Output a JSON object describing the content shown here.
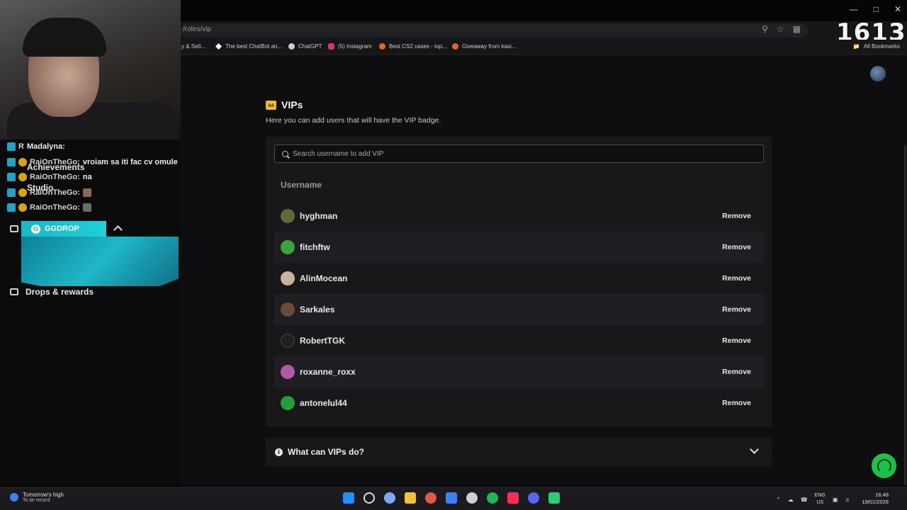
{
  "browser": {
    "url": "/roles/vip",
    "counter": "1613",
    "bookmarks": [
      "y & Sell...",
      "The best ChatBot an...",
      "ChatGPT",
      "(5) Instagram",
      "Best CS2 cases - top...",
      "Giveaway from kasi..."
    ],
    "all_bookmarks": "All Bookmarks",
    "colors": {
      "bm1": "#4a4a4a",
      "bm2": "#ffffff",
      "bm3": "#cfcfcf",
      "bm4": "#e1306c",
      "bm5": "#e0672a",
      "bm6": "#e0672a"
    }
  },
  "page": {
    "section_title": "VIPs",
    "subtitle": "Here you can add users that will have the VIP badge.",
    "search_placeholder": "Search username to add VIP",
    "column_header": "Username",
    "remove_label": "Remove",
    "users": [
      {
        "name": "hyghman",
        "color": "#5c6b3a"
      },
      {
        "name": "fitchftw",
        "color": "#3aa53a"
      },
      {
        "name": "AlinMocean",
        "color": "#c9b29a"
      },
      {
        "name": "Sarkales",
        "color": "#6b4b3a"
      },
      {
        "name": "RobertTGK",
        "color": "#202020"
      },
      {
        "name": "roxanne_roxx",
        "color": "#b05aa6"
      },
      {
        "name": "antonelul44",
        "color": "#1f9e3a"
      }
    ],
    "faq_title": "What can VIPs do?",
    "colors": {
      "accent": "#f1b82d",
      "support": "#19c34a"
    }
  },
  "overlay": {
    "chat": [
      {
        "user": "R",
        "message": "Madalyna:"
      },
      {
        "user": "RaiOnTheGo:",
        "message": "vroiam sa iti fac cv omule"
      },
      {
        "user": "RaiOnTheGo:",
        "message": "na"
      },
      {
        "user": "RaiOnTheGo:",
        "message": ""
      },
      {
        "user": "RaiOnTheGo:",
        "message": ""
      }
    ],
    "side_items": [
      "Achievements",
      "Studio",
      "Drops & rewards"
    ],
    "ggdrop": "GGDROP"
  },
  "taskbar": {
    "weather_main": "Tomorrow's high",
    "weather_sub": "To tie record",
    "lang_top": "ENG",
    "lang_bottom": "US",
    "time": "16:48",
    "date": "19/01/2026",
    "app_colors": [
      "#1e90ff",
      "#dcdcdc",
      "#7aa9ff",
      "#f1c232",
      "#e8534a",
      "#3b82f6",
      "#cfcfcf",
      "#1db954",
      "#ff2d55",
      "#5865f2",
      "#2ecc71"
    ]
  }
}
